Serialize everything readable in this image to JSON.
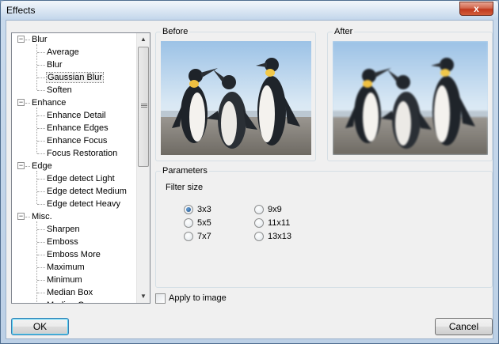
{
  "window": {
    "title": "Effects",
    "close_glyph": "x"
  },
  "tree": {
    "groups": [
      {
        "label": "Blur",
        "items": [
          "Average",
          "Blur",
          "Gaussian Blur",
          "Soften"
        ]
      },
      {
        "label": "Enhance",
        "items": [
          "Enhance Detail",
          "Enhance Edges",
          "Enhance Focus",
          "Focus Restoration"
        ]
      },
      {
        "label": "Edge",
        "items": [
          "Edge detect Light",
          "Edge detect Medium",
          "Edge detect Heavy"
        ]
      },
      {
        "label": "Misc.",
        "items": [
          "Sharpen",
          "Emboss",
          "Emboss More",
          "Maximum",
          "Minimum",
          "Median Box",
          "Median Cross"
        ]
      }
    ],
    "selected": "Gaussian Blur",
    "expander_glyph": "−",
    "scroll_up_glyph": "▲",
    "scroll_down_glyph": "▼"
  },
  "before": {
    "label": "Before"
  },
  "after": {
    "label": "After"
  },
  "parameters": {
    "label": "Parameters",
    "filter_size_label": "Filter size",
    "options": [
      "3x3",
      "5x5",
      "7x7",
      "9x9",
      "11x11",
      "13x13"
    ],
    "selected": "3x3"
  },
  "apply_to_image": {
    "label": "Apply to image",
    "checked": false
  },
  "buttons": {
    "ok": "OK",
    "cancel": "Cancel"
  }
}
